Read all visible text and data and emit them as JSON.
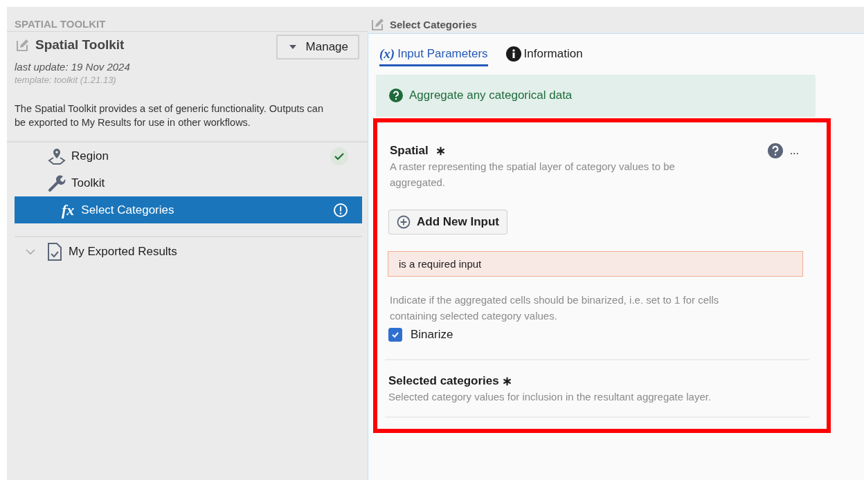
{
  "sidebar": {
    "section_label": "SPATIAL TOOLKIT",
    "title": "Spatial Toolkit",
    "manage_button": "Manage",
    "last_update": "last update: 19 Nov 2024",
    "template": "template: toolkit (1.21.13)",
    "description": "The Spatial Toolkit provides a set of generic functionality. Outputs can be exported to My Results for use in other workflows.",
    "tree": [
      {
        "label": "Region",
        "kind": "pin",
        "completed": true,
        "has_error": false,
        "selected": false
      },
      {
        "label": "Toolkit",
        "kind": "wrench",
        "completed": false,
        "has_error": false,
        "selected": false,
        "children": [
          {
            "label": "Select Categories",
            "kind": "function",
            "glyph": "fx",
            "completed": false,
            "has_error": true,
            "selected": true
          }
        ]
      }
    ],
    "exports": {
      "label": "My Exported Results",
      "expanded": true
    }
  },
  "panel": {
    "title": "Select Categories",
    "tabs": [
      {
        "label": "Input Parameters",
        "kind": "variable",
        "glyph": "(x)",
        "selected": true
      },
      {
        "label": "Information",
        "kind": "info",
        "selected": false
      }
    ],
    "info_banner": "Aggregate any categorical data",
    "parameters": [
      {
        "kind": "input",
        "label": "Spatial",
        "required_mark": "∗",
        "menu": "...",
        "description": "A raster representing the spatial layer of category values to be aggregated.",
        "add_button": "Add New Input",
        "error": "is a required input",
        "option_description": "Indicate if the aggregated cells should be binarized, i.e. set to 1 for cells containing selected category values.",
        "checkbox": {
          "label": "Binarize",
          "checked": true
        }
      },
      {
        "kind": "selection",
        "label": "Selected categories",
        "required_mark": "∗",
        "description": "Selected category values for inclusion in the resultant aggregate layer."
      }
    ]
  }
}
